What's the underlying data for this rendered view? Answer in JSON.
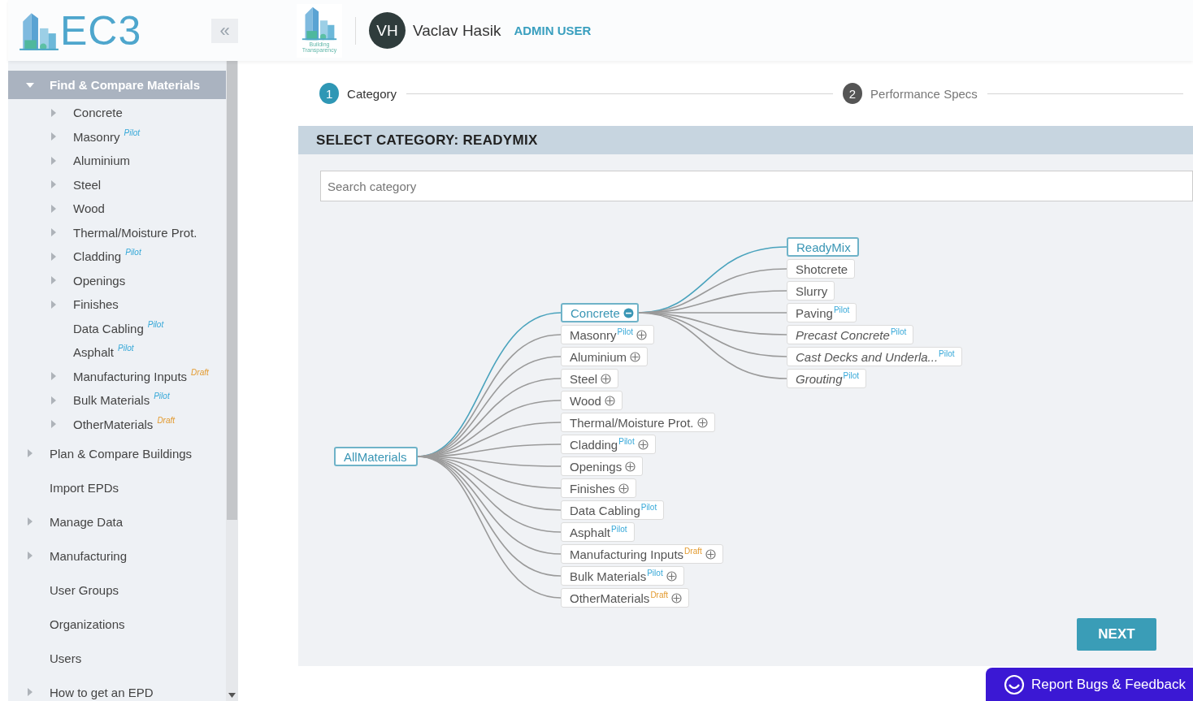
{
  "header": {
    "logo_text": "EC3",
    "collapse_button": "«",
    "partner_logo_caption": "Building Transparency",
    "avatar_initials": "VH",
    "user_name": "Vaclav Hasik",
    "user_role": "ADMIN USER"
  },
  "sidebar": {
    "items": [
      {
        "label": "Find & Compare Materials",
        "expandable": true,
        "expanded": true,
        "selected": true,
        "children": [
          {
            "label": "Concrete",
            "expandable": true,
            "expanded": false,
            "selected": false
          },
          {
            "label": "Masonry",
            "badge": {
              "text": "Pilot",
              "kind": "pilot"
            },
            "expandable": true,
            "expanded": false,
            "selected": false
          },
          {
            "label": "Aluminium",
            "expandable": true,
            "expanded": false,
            "selected": false
          },
          {
            "label": "Steel",
            "expandable": true,
            "expanded": false,
            "selected": false
          },
          {
            "label": "Wood",
            "expandable": true,
            "expanded": false,
            "selected": false
          },
          {
            "label": "Thermal/Moisture Prot.",
            "expandable": true,
            "expanded": false,
            "selected": false
          },
          {
            "label": "Cladding",
            "badge": {
              "text": "Pilot",
              "kind": "pilot"
            },
            "expandable": true,
            "expanded": false,
            "selected": false
          },
          {
            "label": "Openings",
            "expandable": true,
            "expanded": false,
            "selected": false
          },
          {
            "label": "Finishes",
            "expandable": true,
            "expanded": false,
            "selected": false
          },
          {
            "label": "Data Cabling",
            "badge": {
              "text": "Pilot",
              "kind": "pilot"
            },
            "expandable": false,
            "selected": false
          },
          {
            "label": "Asphalt",
            "badge": {
              "text": "Pilot",
              "kind": "pilot"
            },
            "expandable": false,
            "selected": false
          },
          {
            "label": "Manufacturing Inputs",
            "badge": {
              "text": "Draft",
              "kind": "draft"
            },
            "expandable": true,
            "expanded": false,
            "selected": false
          },
          {
            "label": "Bulk Materials",
            "badge": {
              "text": "Pilot",
              "kind": "pilot"
            },
            "expandable": true,
            "expanded": false,
            "selected": false
          },
          {
            "label": "OtherMaterials",
            "badge": {
              "text": "Draft",
              "kind": "draft"
            },
            "expandable": true,
            "expanded": false,
            "selected": false
          }
        ]
      },
      {
        "label": "Plan & Compare Buildings",
        "expandable": true,
        "expanded": false,
        "selected": false
      },
      {
        "label": "Import EPDs",
        "expandable": false,
        "selected": false
      },
      {
        "label": "Manage Data",
        "expandable": true,
        "expanded": false,
        "selected": false
      },
      {
        "label": "Manufacturing",
        "expandable": true,
        "expanded": false,
        "selected": false
      },
      {
        "label": "User Groups",
        "expandable": false,
        "selected": false
      },
      {
        "label": "Organizations",
        "expandable": false,
        "selected": false
      },
      {
        "label": "Users",
        "expandable": false,
        "selected": false
      },
      {
        "label": "How to get an EPD",
        "expandable": true,
        "expanded": false,
        "selected": false
      }
    ]
  },
  "steps": [
    {
      "number": "1",
      "label": "Category",
      "selected": true
    },
    {
      "number": "2",
      "label": "Performance Specs",
      "selected": false
    }
  ],
  "panel": {
    "title": "SELECT CATEGORY: READYMIX",
    "search": {
      "placeholder": "Search category"
    },
    "tree": {
      "label": "AllMaterials",
      "selected": true,
      "children": [
        {
          "label": "Concrete",
          "collapsible": true,
          "expanded": true,
          "italic": false,
          "selected": true,
          "children": [
            {
              "label": "ReadyMix",
              "collapsible": false,
              "italic": false,
              "selected": true
            },
            {
              "label": "Shotcrete",
              "collapsible": false,
              "italic": false,
              "selected": false
            },
            {
              "label": "Slurry",
              "collapsible": false,
              "italic": false,
              "selected": false
            },
            {
              "label": "Paving",
              "badge": {
                "text": "Pilot",
                "kind": "pilot"
              },
              "collapsible": false,
              "italic": false,
              "selected": false
            },
            {
              "label": "Precast Concrete",
              "badge": {
                "text": "Pilot",
                "kind": "pilot"
              },
              "collapsible": false,
              "italic": true,
              "selected": false
            },
            {
              "label": "Cast Decks and Underla...",
              "badge": {
                "text": "Pilot",
                "kind": "pilot"
              },
              "collapsible": false,
              "italic": true,
              "selected": false
            },
            {
              "label": "Grouting",
              "badge": {
                "text": "Pilot",
                "kind": "pilot"
              },
              "collapsible": false,
              "italic": true,
              "selected": false
            }
          ]
        },
        {
          "label": "Masonry",
          "badge": {
            "text": "Pilot",
            "kind": "pilot"
          },
          "collapsible": true,
          "expanded": false,
          "italic": false,
          "selected": false
        },
        {
          "label": "Aluminium",
          "collapsible": true,
          "expanded": false,
          "italic": false,
          "selected": false
        },
        {
          "label": "Steel",
          "collapsible": true,
          "expanded": false,
          "italic": false,
          "selected": false
        },
        {
          "label": "Wood",
          "collapsible": true,
          "expanded": false,
          "italic": false,
          "selected": false
        },
        {
          "label": "Thermal/Moisture Prot.",
          "collapsible": true,
          "expanded": false,
          "italic": false,
          "selected": false
        },
        {
          "label": "Cladding",
          "badge": {
            "text": "Pilot",
            "kind": "pilot"
          },
          "collapsible": true,
          "expanded": false,
          "italic": false,
          "selected": false
        },
        {
          "label": "Openings",
          "collapsible": true,
          "expanded": false,
          "italic": false,
          "selected": false
        },
        {
          "label": "Finishes",
          "collapsible": true,
          "expanded": false,
          "italic": false,
          "selected": false
        },
        {
          "label": "Data Cabling",
          "badge": {
            "text": "Pilot",
            "kind": "pilot"
          },
          "collapsible": false,
          "italic": false,
          "selected": false
        },
        {
          "label": "Asphalt",
          "badge": {
            "text": "Pilot",
            "kind": "pilot"
          },
          "collapsible": false,
          "italic": false,
          "selected": false
        },
        {
          "label": "Manufacturing Inputs",
          "badge": {
            "text": "Draft",
            "kind": "draft"
          },
          "collapsible": true,
          "expanded": false,
          "italic": false,
          "selected": false
        },
        {
          "label": "Bulk Materials",
          "badge": {
            "text": "Pilot",
            "kind": "pilot"
          },
          "collapsible": true,
          "expanded": false,
          "italic": false,
          "selected": false
        },
        {
          "label": "OtherMaterials",
          "badge": {
            "text": "Draft",
            "kind": "draft"
          },
          "collapsible": true,
          "expanded": false,
          "italic": false,
          "selected": false
        }
      ]
    },
    "next_button": "NEXT"
  },
  "feedback_button": "Report Bugs & Feedback"
}
